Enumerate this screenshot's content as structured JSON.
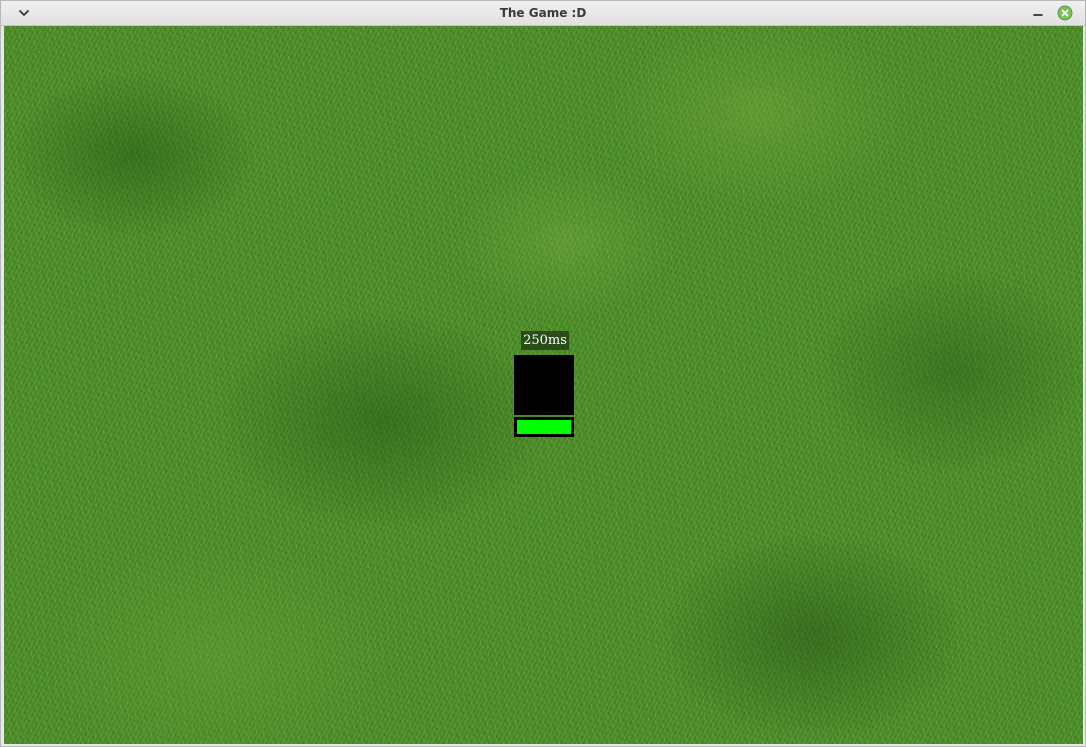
{
  "window": {
    "title": "The Game :D",
    "icons": [
      "chevron-down-icon",
      "minimize-icon",
      "close-icon"
    ],
    "close_color": "#7bbf58"
  },
  "game": {
    "background": "grass",
    "ping_label": "250ms",
    "player_color": "#000000",
    "health": {
      "fraction": 1.0,
      "color": "#00ff00"
    }
  }
}
